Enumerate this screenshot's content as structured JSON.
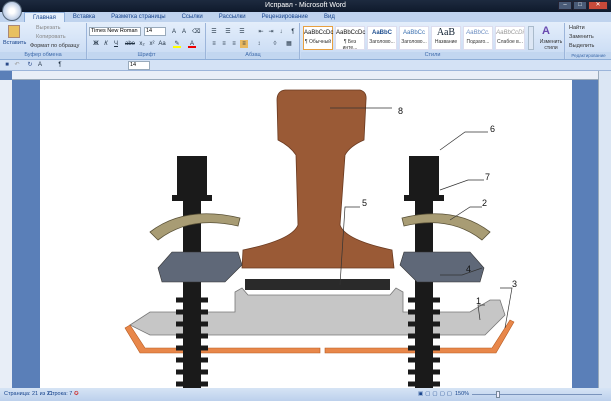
{
  "window": {
    "title": "Исправл - Microsoft Word",
    "min": "–",
    "max": "□",
    "close": "✕"
  },
  "tabs": [
    "Главная",
    "Вставка",
    "Разметка страницы",
    "Ссылки",
    "Рассылки",
    "Рецензирование",
    "Вид"
  ],
  "clipboard": {
    "paste": "Вставить",
    "cut": "Вырезать",
    "copy": "Копировать",
    "format": "Формат по образцу",
    "label": "Буфер обмена"
  },
  "font": {
    "name": "Times New Roman",
    "size": "14",
    "label": "Шрифт",
    "buttons": [
      "Ж",
      "К",
      "Ч",
      "abe",
      "x₂",
      "x²",
      "Aa"
    ]
  },
  "paragraph": {
    "label": "Абзац"
  },
  "styles": {
    "label": "Стили",
    "items": [
      {
        "preview": "AaBbCcDc",
        "name": "¶ Обычный"
      },
      {
        "preview": "AaBbCcDc",
        "name": "¶ Без инте..."
      },
      {
        "preview": "AaBbC",
        "name": "Заголово..."
      },
      {
        "preview": "AaBbCc",
        "name": "Заголово..."
      },
      {
        "preview": "АаВ",
        "name": "Название"
      },
      {
        "preview": "AaBbCc.",
        "name": "Подзаго..."
      },
      {
        "preview": "AaBbCcDi",
        "name": "Слабое в..."
      }
    ],
    "change": "Изменить стили"
  },
  "editing": {
    "label": "Редактирование",
    "find": "Найти",
    "replace": "Заменить",
    "select": "Выделить"
  },
  "qat": {
    "size": "14"
  },
  "diagram": {
    "labels": [
      "1",
      "2",
      "3",
      "4",
      "5",
      "6",
      "7",
      "8"
    ]
  },
  "status": {
    "page": "Страница: 21 из 21",
    "line": "Строка: 7",
    "zoom": "150%"
  }
}
